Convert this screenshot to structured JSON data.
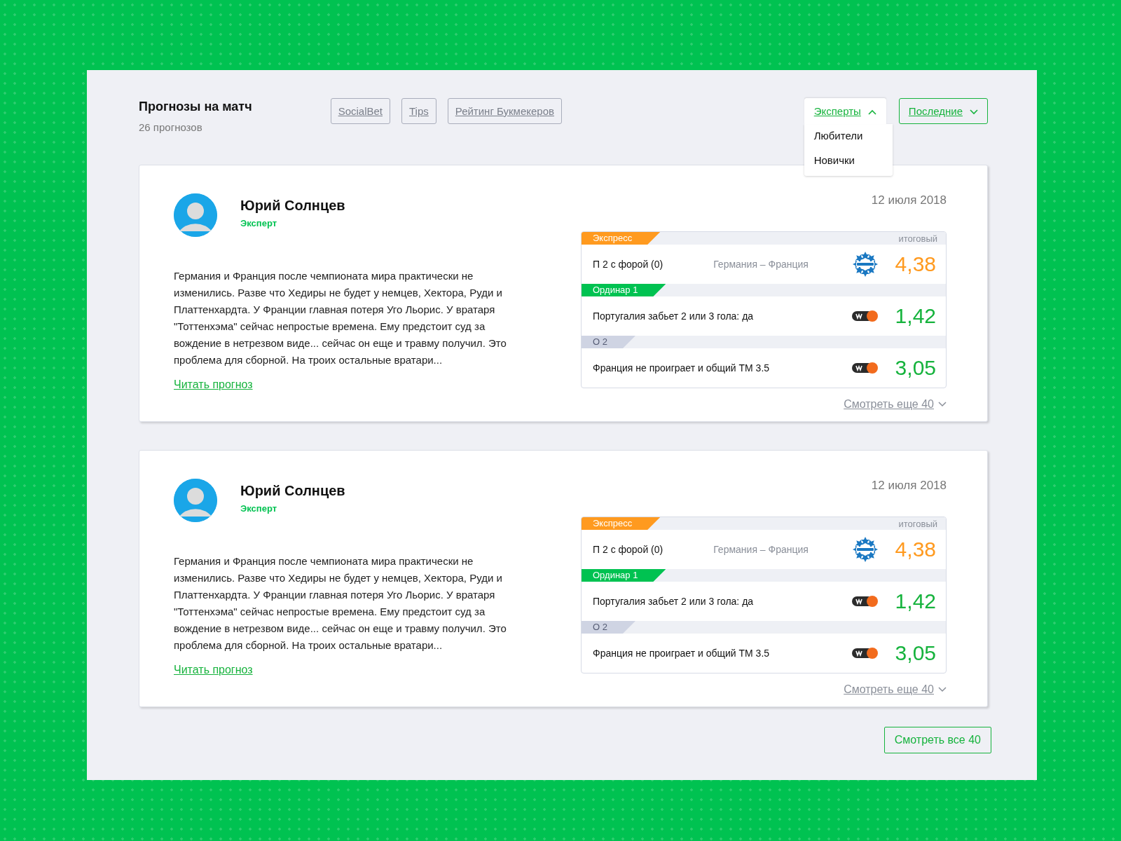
{
  "header": {
    "title": "Прогнозы на матч",
    "count": "26 прогнозов"
  },
  "filters": [
    {
      "label": "SocialBet"
    },
    {
      "label": "Tips"
    },
    {
      "label": "Рейтинг Букмекеров"
    }
  ],
  "dropdowns": [
    {
      "label": "Эксперты",
      "expanded": true,
      "options": [
        "Любители",
        "Новички"
      ]
    },
    {
      "label": "Последние",
      "expanded": false
    }
  ],
  "cards": [
    {
      "author": "Юрий Солнцев",
      "role": "Эксперт",
      "date": "12 июля 2018",
      "text": "Германия и Франция после чемпионата мира практически не изменились. Разве что Хедиры не будет у немцев, Хектора, Руди и Платтенхардта. У Франции главная потеря Уго Льорис. У вратаря \"Тоттенхэма\" сейчас непростые времена. Ему предстоит суд за вождение в нетрезвом виде... сейчас он еще и травму получил. Это проблема для сборной. На троих остальные вратари...",
      "read_link": "Читать прогноз",
      "bets": [
        {
          "kind": "express",
          "tag": "Экспресс",
          "note": "итоговый",
          "pick": "П 2 с форой (0)",
          "match": "Германия – Франция",
          "logo": {
            "kind": "betcity"
          },
          "odds": "4,38"
        },
        {
          "kind": "single",
          "tag": "Ординар 1",
          "pick": "Португалия забьет 2 или 3 гола: да",
          "logo": {
            "kind": "w"
          },
          "odds": "1,42"
        },
        {
          "kind": "system",
          "tag": "О 2",
          "pick": "Франция не проиграет и общий ТМ 3.5",
          "logo": {
            "kind": "w"
          },
          "odds": "3,05"
        }
      ],
      "more_link": "Смотреть еще 40"
    },
    {
      "author": "Юрий Солнцев",
      "role": "Эксперт",
      "date": "12 июля 2018",
      "text": "Германия и Франция после чемпионата мира практически не изменились. Разве что Хедиры не будет у немцев, Хектора, Руди и Платтенхардта. У Франции главная потеря Уго Льорис. У вратаря \"Тоттенхэма\" сейчас непростые времена. Ему предстоит суд за вождение в нетрезвом виде... сейчас он еще и травму получил. Это проблема для сборной. На троих остальные вратари...",
      "read_link": "Читать прогноз",
      "bets": [
        {
          "kind": "express",
          "tag": "Экспресс",
          "note": "итоговый",
          "pick": "П 2 с форой (0)",
          "match": "Германия – Франция",
          "logo": {
            "kind": "betcity"
          },
          "odds": "4,38"
        },
        {
          "kind": "single",
          "tag": "Ординар 1",
          "pick": "Португалия забьет 2 или 3 гола: да",
          "logo": {
            "kind": "w"
          },
          "odds": "1,42"
        },
        {
          "kind": "system",
          "tag": "О 2",
          "pick": "Франция не проиграет и общий ТМ 3.5",
          "logo": {
            "kind": "w"
          },
          "odds": "3,05"
        }
      ],
      "more_link": "Смотреть еще 40"
    }
  ],
  "footer_button": "Смотреть все 40"
}
